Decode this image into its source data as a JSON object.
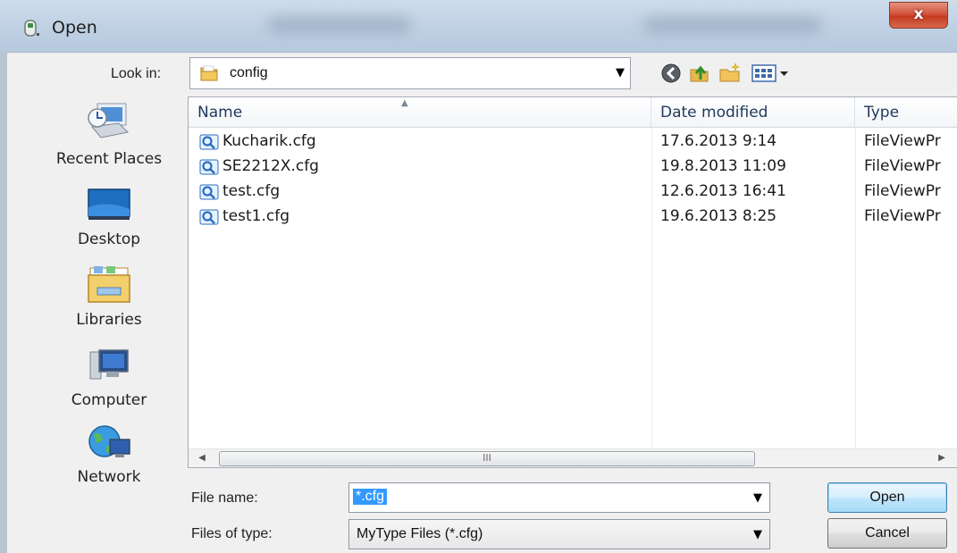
{
  "window": {
    "title": "Open",
    "close_glyph": "x"
  },
  "lookin": {
    "label": "Look in:",
    "value": "config",
    "folder_icon": "folder-icon"
  },
  "toolbar": {
    "icons": [
      "back-icon",
      "up-folder-icon",
      "new-folder-icon",
      "view-menu-icon"
    ]
  },
  "places": [
    {
      "label": "Recent Places",
      "icon": "recent-places-icon"
    },
    {
      "label": "Desktop",
      "icon": "desktop-icon"
    },
    {
      "label": "Libraries",
      "icon": "libraries-icon"
    },
    {
      "label": "Computer",
      "icon": "computer-icon"
    },
    {
      "label": "Network",
      "icon": "network-icon"
    }
  ],
  "filelist": {
    "columns": [
      "Name",
      "Date modified",
      "Type"
    ],
    "rows": [
      {
        "name": "Kucharik.cfg",
        "date": "17.6.2013 9:14",
        "type": "FileViewPr"
      },
      {
        "name": "SE2212X.cfg",
        "date": "19.8.2013 11:09",
        "type": "FileViewPr"
      },
      {
        "name": "test.cfg",
        "date": "12.6.2013 16:41",
        "type": "FileViewPr"
      },
      {
        "name": "test1.cfg",
        "date": "19.6.2013 8:25",
        "type": "FileViewPr"
      }
    ],
    "scroll_thumb_glyph": "III"
  },
  "filename": {
    "label": "File name:",
    "value": "*.cfg"
  },
  "filetype": {
    "label": "Files of type:",
    "value": "MyType Files (*.cfg)"
  },
  "buttons": {
    "open": "Open",
    "cancel": "Cancel"
  },
  "colors": {
    "selection": "#3399ff",
    "header_text": "#1e395b",
    "close_red": "#c63a1f"
  }
}
